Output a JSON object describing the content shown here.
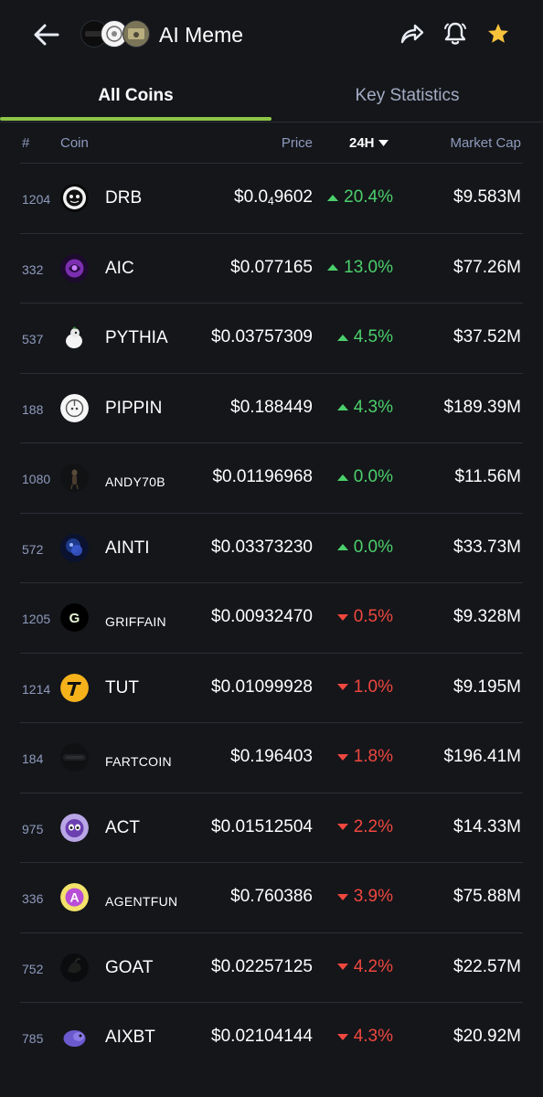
{
  "header": {
    "title": "AI Meme",
    "back_icon": "arrow-left-icon",
    "share_icon": "share-icon",
    "bell_icon": "bell-icon",
    "star_icon": "star-icon",
    "star_color": "#f7c23b"
  },
  "tabs": [
    {
      "label": "All Coins",
      "active": true
    },
    {
      "label": "Key Statistics",
      "active": false
    }
  ],
  "accent_color": "#8dc647",
  "table": {
    "headers": {
      "rank": "#",
      "coin": "Coin",
      "price": "Price",
      "change": "24H",
      "market_cap": "Market Cap"
    },
    "rows": [
      {
        "rank": "1204",
        "symbol": "DRB",
        "price_main": "$0.0",
        "price_sub": "4",
        "price_rest": "9602",
        "change": "20.4%",
        "dir": "up",
        "market_cap": "$9.583M",
        "icon": "drb-coin-icon",
        "small": false
      },
      {
        "rank": "332",
        "symbol": "AIC",
        "price_main": "$0.077165",
        "price_sub": "",
        "price_rest": "",
        "change": "13.0%",
        "dir": "up",
        "market_cap": "$77.26M",
        "icon": "aic-coin-icon",
        "small": false
      },
      {
        "rank": "537",
        "symbol": "PYTHIA",
        "price_main": "$0.03757309",
        "price_sub": "",
        "price_rest": "",
        "change": "4.5%",
        "dir": "up",
        "market_cap": "$37.52M",
        "icon": "pythia-coin-icon",
        "small": false
      },
      {
        "rank": "188",
        "symbol": "PIPPIN",
        "price_main": "$0.188449",
        "price_sub": "",
        "price_rest": "",
        "change": "4.3%",
        "dir": "up",
        "market_cap": "$189.39M",
        "icon": "pippin-coin-icon",
        "small": false
      },
      {
        "rank": "1080",
        "symbol": "ANDY70B",
        "price_main": "$0.01196968",
        "price_sub": "",
        "price_rest": "",
        "change": "0.0%",
        "dir": "up",
        "market_cap": "$11.56M",
        "icon": "andy70b-coin-icon",
        "small": true
      },
      {
        "rank": "572",
        "symbol": "AINTI",
        "price_main": "$0.03373230",
        "price_sub": "",
        "price_rest": "",
        "change": "0.0%",
        "dir": "up",
        "market_cap": "$33.73M",
        "icon": "ainti-coin-icon",
        "small": false
      },
      {
        "rank": "1205",
        "symbol": "GRIFFAIN",
        "price_main": "$0.00932470",
        "price_sub": "",
        "price_rest": "",
        "change": "0.5%",
        "dir": "down",
        "market_cap": "$9.328M",
        "icon": "griffain-coin-icon",
        "small": true
      },
      {
        "rank": "1214",
        "symbol": "TUT",
        "price_main": "$0.01099928",
        "price_sub": "",
        "price_rest": "",
        "change": "1.0%",
        "dir": "down",
        "market_cap": "$9.195M",
        "icon": "tut-coin-icon",
        "small": false
      },
      {
        "rank": "184",
        "symbol": "FARTCOIN",
        "price_main": "$0.196403",
        "price_sub": "",
        "price_rest": "",
        "change": "1.8%",
        "dir": "down",
        "market_cap": "$196.41M",
        "icon": "fartcoin-coin-icon",
        "small": true
      },
      {
        "rank": "975",
        "symbol": "ACT",
        "price_main": "$0.01512504",
        "price_sub": "",
        "price_rest": "",
        "change": "2.2%",
        "dir": "down",
        "market_cap": "$14.33M",
        "icon": "act-coin-icon",
        "small": false
      },
      {
        "rank": "336",
        "symbol": "AGENTFUN",
        "price_main": "$0.760386",
        "price_sub": "",
        "price_rest": "",
        "change": "3.9%",
        "dir": "down",
        "market_cap": "$75.88M",
        "icon": "agentfun-coin-icon",
        "small": true
      },
      {
        "rank": "752",
        "symbol": "GOAT",
        "price_main": "$0.02257125",
        "price_sub": "",
        "price_rest": "",
        "change": "4.2%",
        "dir": "down",
        "market_cap": "$22.57M",
        "icon": "goat-coin-icon",
        "small": false
      },
      {
        "rank": "785",
        "symbol": "AIXBT",
        "price_main": "$0.02104144",
        "price_sub": "",
        "price_rest": "",
        "change": "4.3%",
        "dir": "down",
        "market_cap": "$20.92M",
        "icon": "aixbt-coin-icon",
        "small": false
      }
    ]
  },
  "colors": {
    "up": "#4cd06b",
    "down": "#f0473f",
    "background": "#14161a",
    "muted": "#8f9bbd"
  }
}
